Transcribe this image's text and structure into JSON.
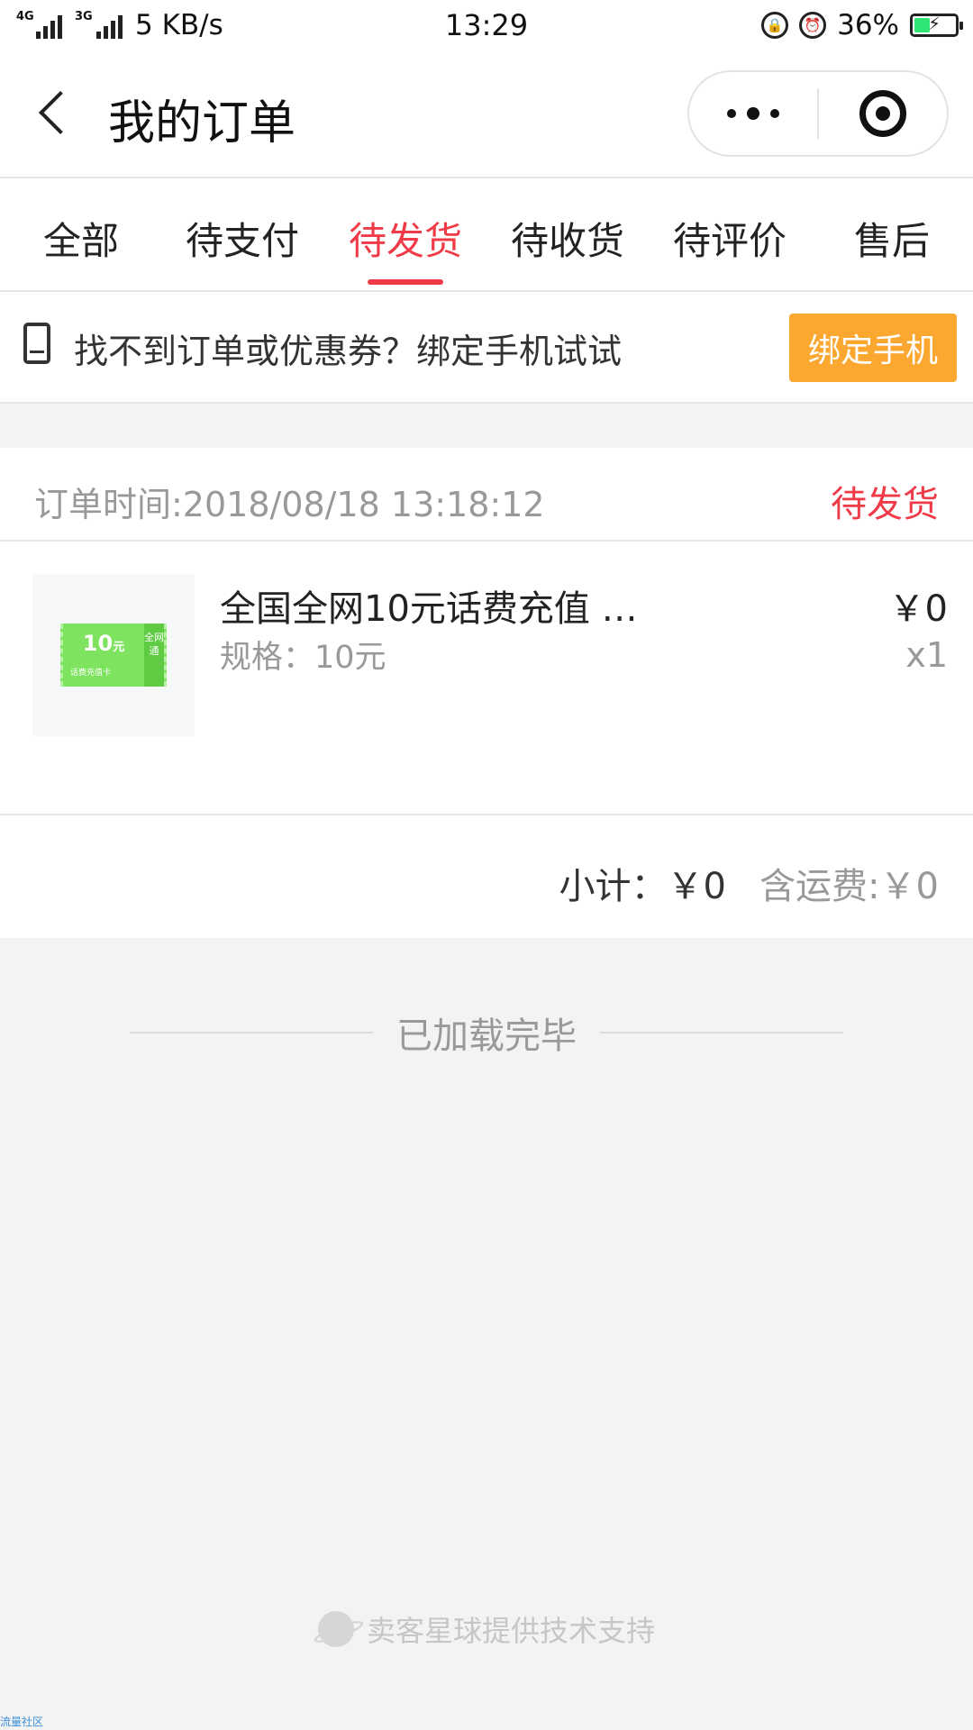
{
  "status_bar": {
    "network_1": "4G",
    "network_2": "3G",
    "speed": "5 KB/s",
    "time": "13:29",
    "battery": "36%",
    "battery_level": 0.36
  },
  "nav": {
    "title": "我的订单"
  },
  "tabs": [
    {
      "label": "全部"
    },
    {
      "label": "待支付"
    },
    {
      "label": "待发货"
    },
    {
      "label": "待收货"
    },
    {
      "label": "待评价"
    },
    {
      "label": "售后"
    }
  ],
  "active_tab": "待发货",
  "bind_banner": {
    "text": "找不到订单或优惠券？绑定手机试试",
    "button": "绑定手机"
  },
  "order": {
    "time": "订单时间:2018/08/18 13:18:12",
    "status": "待发货",
    "item": {
      "title": "全国全网10元话费充值 …",
      "spec": "规格：10元",
      "price": "￥0",
      "qty": "x1",
      "thumb_amount": "10",
      "thumb_unit": "元",
      "thumb_caption": "话费充值卡",
      "thumb_side": "全网通"
    },
    "subtotal": "小计：￥0",
    "shipping": "含运费:￥0"
  },
  "list_end": "已加载完毕",
  "support": "卖客星球提供技术支持",
  "watermark": "流量社区",
  "colors": {
    "accent": "#ef3b47",
    "button": "#fba730",
    "background": "#f3f3f3"
  }
}
